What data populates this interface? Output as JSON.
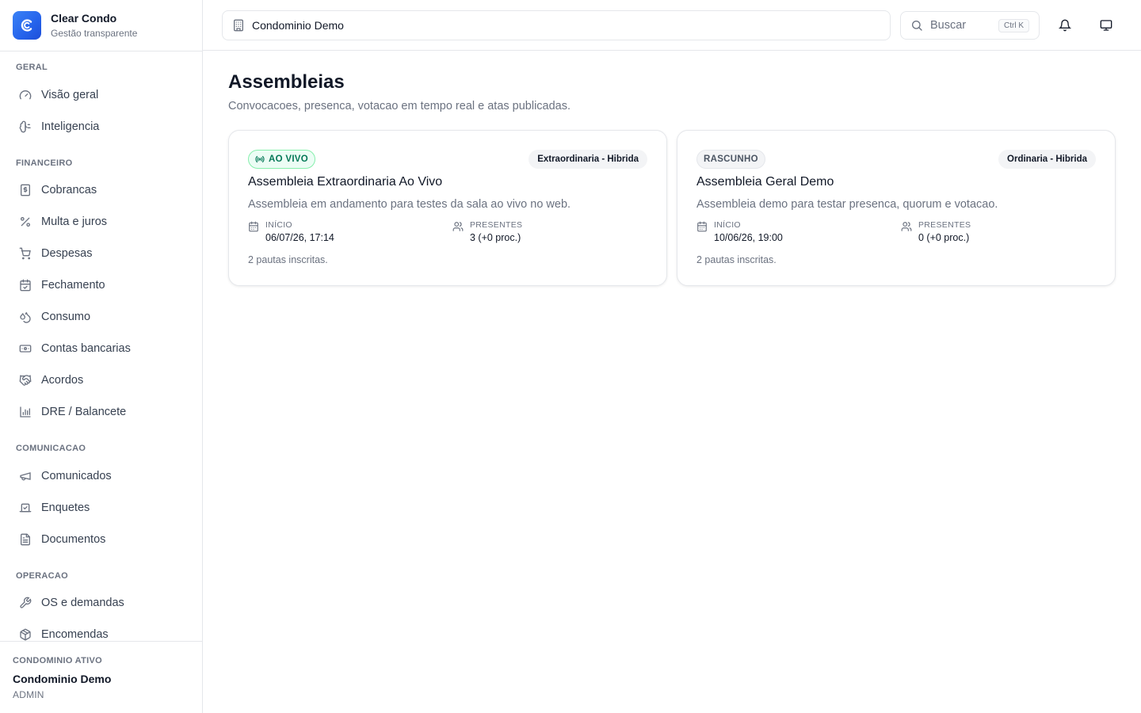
{
  "brand": {
    "name": "Clear Condo",
    "tagline": "Gestão transparente",
    "icon": "brand-logo-icon",
    "color": "#2563eb"
  },
  "sidebar": {
    "groups": [
      {
        "label": "GERAL",
        "items": [
          {
            "label": "Visão geral",
            "icon": "gauge-icon"
          },
          {
            "label": "Inteligencia",
            "icon": "brain-icon"
          }
        ]
      },
      {
        "label": "FINANCEIRO",
        "items": [
          {
            "label": "Cobrancas",
            "icon": "receipt-dollar-icon"
          },
          {
            "label": "Multa e juros",
            "icon": "percent-icon"
          },
          {
            "label": "Despesas",
            "icon": "cart-icon"
          },
          {
            "label": "Fechamento",
            "icon": "calendar-check-icon"
          },
          {
            "label": "Consumo",
            "icon": "droplets-icon"
          },
          {
            "label": "Contas bancarias",
            "icon": "banknote-icon"
          },
          {
            "label": "Acordos",
            "icon": "handshake-icon"
          },
          {
            "label": "DRE / Balancete",
            "icon": "bar-chart-icon"
          }
        ]
      },
      {
        "label": "COMUNICACAO",
        "items": [
          {
            "label": "Comunicados",
            "icon": "megaphone-icon"
          },
          {
            "label": "Enquetes",
            "icon": "vote-icon"
          },
          {
            "label": "Documentos",
            "icon": "file-text-icon"
          }
        ]
      },
      {
        "label": "OPERACAO",
        "items": [
          {
            "label": "OS e demandas",
            "icon": "wrench-icon"
          },
          {
            "label": "Encomendas",
            "icon": "package-icon"
          }
        ]
      }
    ],
    "footer": {
      "label": "CONDOMINIO ATIVO",
      "name": "Condominio Demo",
      "role": "ADMIN"
    }
  },
  "topbar": {
    "condominio": "Condominio Demo",
    "search": {
      "placeholder": "Buscar",
      "shortcut": "Ctrl K"
    },
    "icons": [
      "bell-icon",
      "monitor-icon"
    ]
  },
  "page": {
    "title": "Assembleias",
    "subtitle": "Convocacoes, presenca, votacao em tempo real e atas publicadas."
  },
  "assemblies": [
    {
      "status": "AO VIVO",
      "type": "Extraordinaria - Hibrida",
      "title": "Assembleia Extraordinaria Ao Vivo",
      "description": "Assembleia em andamento para testes da sala ao vivo no web.",
      "start_label": "INÍCIO",
      "start": "06/07/26, 17:14",
      "present_label": "PRESENTES",
      "present": "3 (+0 proc.)",
      "footer": "2 pautas inscritas."
    },
    {
      "status": "RASCUNHO",
      "type": "Ordinaria - Hibrida",
      "title": "Assembleia Geral Demo",
      "description": "Assembleia demo para testar presenca, quorum e votacao.",
      "start_label": "INÍCIO",
      "start": "10/06/26, 19:00",
      "present_label": "PRESENTES",
      "present": "0 (+0 proc.)",
      "footer": "2 pautas inscritas."
    }
  ],
  "colors": {
    "live_text": "#047857",
    "live_bg": "#ecfdf5",
    "border": "#e5e7eb",
    "muted": "#6b7280"
  }
}
